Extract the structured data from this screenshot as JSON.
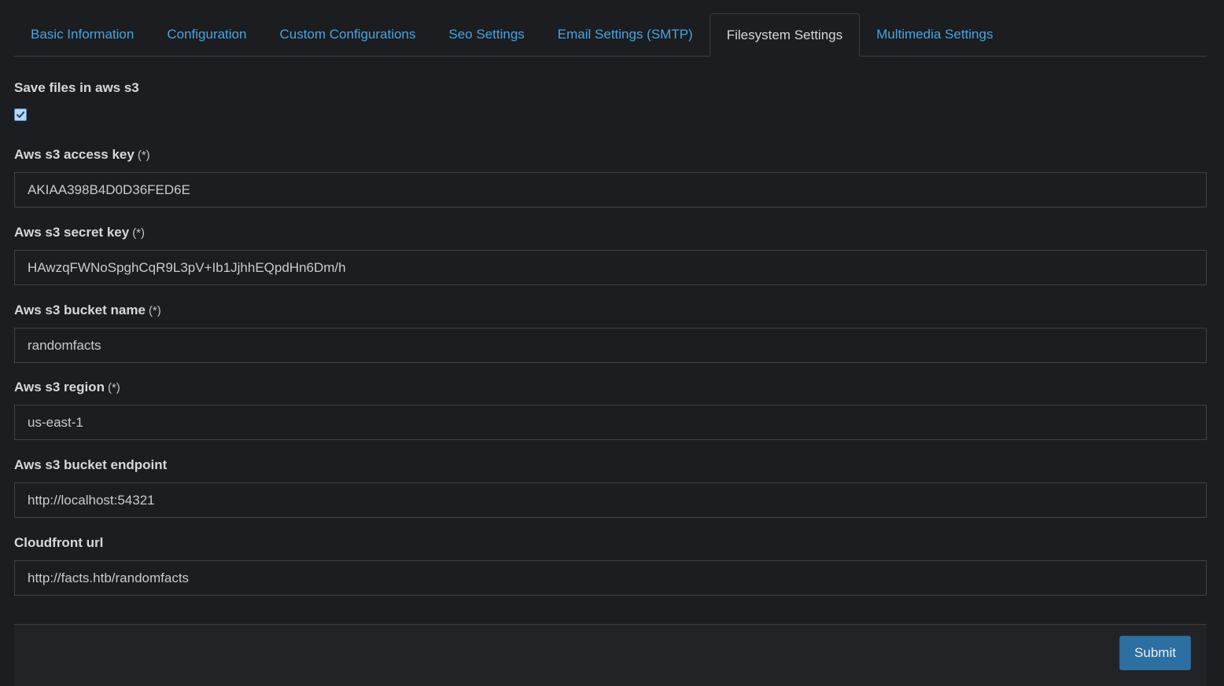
{
  "tabs": [
    {
      "label": "Basic Information",
      "active": false
    },
    {
      "label": "Configuration",
      "active": false
    },
    {
      "label": "Custom Configurations",
      "active": false
    },
    {
      "label": "Seo Settings",
      "active": false
    },
    {
      "label": "Email Settings (SMTP)",
      "active": false
    },
    {
      "label": "Filesystem Settings",
      "active": true
    },
    {
      "label": "Multimedia Settings",
      "active": false
    }
  ],
  "form": {
    "save_files_label": "Save files in aws s3",
    "save_files_checked": true,
    "required_marker": "(*)",
    "fields": {
      "access_key": {
        "label": "Aws s3 access key",
        "value": "AKIAA398B4D0D36FED6E"
      },
      "secret_key": {
        "label": "Aws s3 secret key",
        "value": "HAwzqFWNoSpghCqR9L3pV+Ib1JjhhEQpdHn6Dm/h"
      },
      "bucket_name": {
        "label": "Aws s3 bucket name",
        "value": "randomfacts"
      },
      "region": {
        "label": "Aws s3 region",
        "value": "us-east-1"
      },
      "bucket_endpoint": {
        "label": "Aws s3 bucket endpoint",
        "value": "http://localhost:54321"
      },
      "cloudfront_url": {
        "label": "Cloudfront url",
        "value": "http://facts.htb/randomfacts"
      }
    }
  },
  "footer": {
    "submit_label": "Submit"
  },
  "colors": {
    "background": "#1b1d20",
    "link": "#4aa3df",
    "button": "#2d6fa0"
  }
}
